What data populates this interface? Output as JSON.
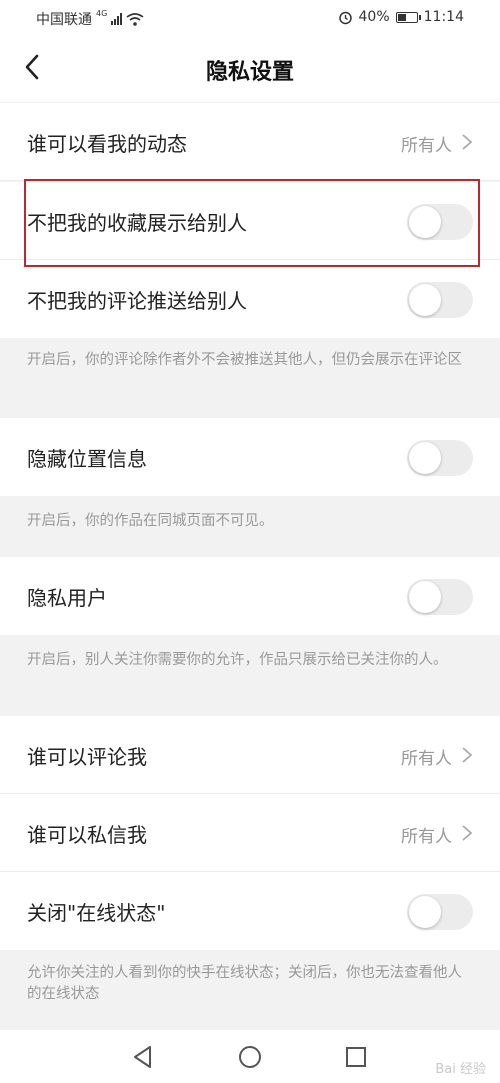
{
  "status_bar": {
    "carrier": "中国联通",
    "network": "4G",
    "battery": "40%",
    "time": "11:14"
  },
  "header": {
    "title": "隐私设置"
  },
  "rows": {
    "dynamic": {
      "label": "谁可以看我的动态",
      "value": "所有人"
    },
    "favorites": {
      "label": "不把我的收藏展示给别人",
      "enabled": false
    },
    "comments_push": {
      "label": "不把我的评论推送给别人",
      "enabled": false
    },
    "location": {
      "label": "隐藏位置信息",
      "enabled": false
    },
    "private_user": {
      "label": "隐私用户",
      "enabled": false
    },
    "who_comment": {
      "label": "谁可以评论我",
      "value": "所有人"
    },
    "who_message": {
      "label": "谁可以私信我",
      "value": "所有人"
    },
    "online_status": {
      "label": "关闭\"在线状态\"",
      "enabled": false
    }
  },
  "notes": {
    "comments_push": "开启后，你的评论除作者外不会被推送其他人，但仍会展示在评论区",
    "location": "开启后，你的作品在同城页面不可见。",
    "private_user": "开启后，别人关注你需要你的允许，作品只展示给已关注你的人。",
    "online_status": "允许你关注的人看到你的快手在线状态；关闭后，你也无法查看他人的在线状态"
  },
  "watermark": "Bai 经验",
  "colors": {
    "highlight": "#c0272d",
    "toggle_off": "#ececec"
  }
}
